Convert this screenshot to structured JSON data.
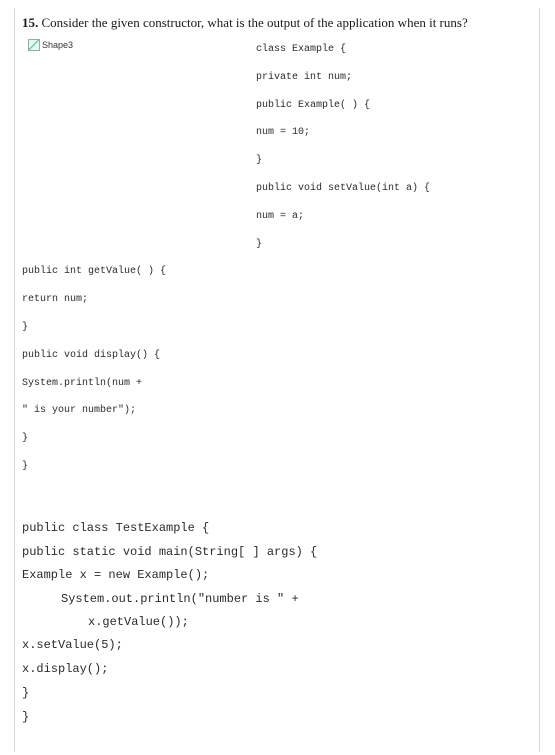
{
  "question": {
    "number": "15.",
    "text": " Consider the given constructor, what is the output of the application when it runs?"
  },
  "image_alt": "Shape3",
  "code_right": [
    "class Example {",
    "private int num;",
    "public Example( ) {",
    "num = 10;",
    "}",
    "public void setValue(int a) {",
    "num = a;",
    "}"
  ],
  "code_left": [
    "public int getValue( ) {",
    "return num;",
    "}",
    "public void display() {",
    "System.println(num +",
    "\" is your number\");",
    "}",
    "}"
  ],
  "code_main": [
    "public class TestExample {",
    "public static void main(String[ ] args) {",
    "Example x = new Example();",
    "System.out.println(\"number is \" +",
    "x.getValue());",
    "x.setValue(5);",
    "x.display();",
    "}",
    "}"
  ]
}
